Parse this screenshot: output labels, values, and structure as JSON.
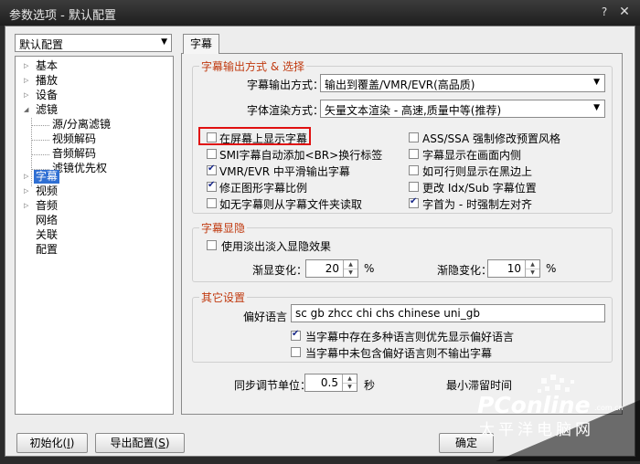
{
  "window": {
    "title": "参数选项 - 默认配置",
    "help_glyph": "?",
    "close_glyph": "✕"
  },
  "preset": {
    "value": "默认配置"
  },
  "tree": {
    "items": [
      {
        "label": "基本"
      },
      {
        "label": "播放"
      },
      {
        "label": "设备"
      },
      {
        "label": "滤镜"
      },
      {
        "label": "源/分离滤镜"
      },
      {
        "label": "视频解码"
      },
      {
        "label": "音频解码"
      },
      {
        "label": "滤镜优先权"
      },
      {
        "label": "字幕"
      },
      {
        "label": "视频"
      },
      {
        "label": "音频"
      },
      {
        "label": "网络"
      },
      {
        "label": "关联"
      },
      {
        "label": "配置"
      }
    ],
    "selected": "字幕"
  },
  "tab": {
    "label": "字幕"
  },
  "output_group": {
    "title": "字幕输出方式 & 选择",
    "mode_label": "字幕输出方式：",
    "mode_value": "输出到覆盖/VMR/EVR(高品质)",
    "render_label": "字体渲染方式：",
    "render_value": "矢量文本渲染 - 高速,质量中等(推荐)",
    "checks_left": [
      {
        "label": "在屏幕上显示字幕",
        "checked": false
      },
      {
        "label": "SMI字幕自动添加<BR>换行标签",
        "checked": false
      },
      {
        "label": "VMR/EVR 中平滑输出字幕",
        "checked": true
      },
      {
        "label": "修正图形字幕比例",
        "checked": true
      },
      {
        "label": "如无字幕则从字幕文件夹读取",
        "checked": false
      }
    ],
    "checks_right": [
      {
        "label": "ASS/SSA 强制修改预置风格",
        "checked": false
      },
      {
        "label": "字幕显示在画面内侧",
        "checked": false
      },
      {
        "label": "如可行则显示在黑边上",
        "checked": false
      },
      {
        "label": "更改 Idx/Sub 字幕位置",
        "checked": false
      },
      {
        "label": "字首为 - 时强制左对齐",
        "checked": true
      }
    ]
  },
  "fade_group": {
    "title": "字幕显隐",
    "use_fade_label": "使用淡出淡入显隐效果",
    "fade_in_label": "渐显变化：",
    "fade_in_value": "20",
    "fade_in_unit": "%",
    "fade_out_label": "渐隐变化：",
    "fade_out_value": "10",
    "fade_out_unit": "%"
  },
  "other_group": {
    "title": "其它设置",
    "pref_lang_label": "偏好语言",
    "pref_lang_value": "sc gb zhcc chi chs chinese uni_gb",
    "check_multi": "当字幕中存在多种语言则优先显示偏好语言",
    "check_none": "当字幕中未包含偏好语言则不输出字幕"
  },
  "sync": {
    "label": "同步调节单位：",
    "value": "0.5",
    "unit": "秒",
    "min_time_label": "最小滞留时间"
  },
  "buttons": {
    "init_label": "初始化(",
    "init_key": "I",
    "export_label": "导出配置(",
    "export_key": "S",
    "ok_label": "确定"
  },
  "watermark": {
    "logo": "PConline",
    "domain": ".com.cn",
    "cn": "太平洋电脑网"
  },
  "colors": {
    "accent": "#c03a10",
    "selection": "#2f6fd3",
    "highlight_box": "#e01010"
  }
}
